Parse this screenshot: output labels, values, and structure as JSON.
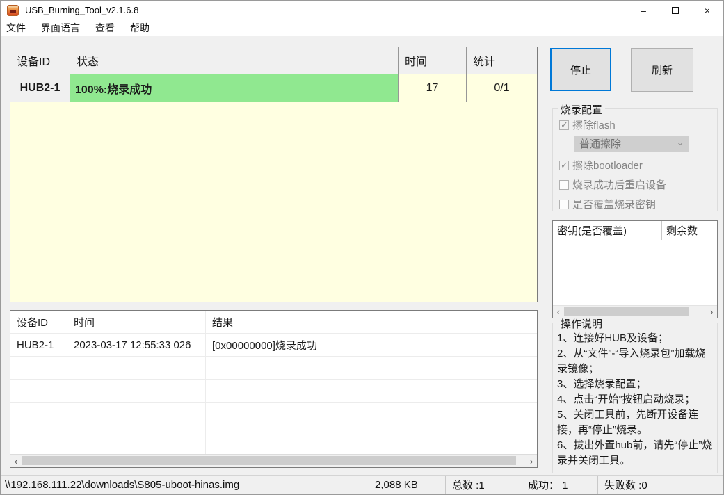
{
  "window": {
    "title": "USB_Burning_Tool_v2.1.6.8"
  },
  "menu": {
    "items": [
      "文件",
      "界面语言",
      "查看",
      "帮助"
    ]
  },
  "device_table": {
    "headers": [
      "设备ID",
      "状态",
      "时间",
      "统计"
    ],
    "rows": [
      {
        "id": "HUB2-1",
        "status": "100%:烧录成功",
        "time": "17",
        "stat": "0/1"
      }
    ]
  },
  "toolbar": {
    "stop_label": "停止",
    "refresh_label": "刷新"
  },
  "burn_config": {
    "title": "烧录配置",
    "erase_flash_label": "擦除flash",
    "erase_flash_checked": true,
    "erase_mode_value": "普通擦除",
    "erase_bootloader_label": "擦除bootloader",
    "erase_bootloader_checked": true,
    "reboot_label": "烧录成功后重启设备",
    "reboot_checked": false,
    "overwrite_key_label": "是否覆盖烧录密钥",
    "overwrite_key_checked": false
  },
  "key_table": {
    "headers": [
      "密钥(是否覆盖)",
      "剩余数"
    ],
    "rows": []
  },
  "instructions": {
    "title": "操作说明",
    "steps": [
      "1、连接好HUB及设备；",
      "2、从“文件”-“导入烧录包”加载烧录镜像；",
      "3、选择烧录配置；",
      "4、点击“开始”按钮启动烧录；",
      "5、关闭工具前，先断开设备连接，再“停止”烧录。",
      "6、拔出外置hub前，请先“停止”烧录并关闭工具。"
    ]
  },
  "log_table": {
    "headers": [
      "设备ID",
      "时间",
      "结果"
    ],
    "rows": [
      {
        "id": "HUB2-1",
        "time": "2023-03-17 12:55:33 026",
        "result": "[0x00000000]烧录成功"
      }
    ]
  },
  "statusbar": {
    "path": "\\\\192.168.111.22\\downloads\\S805-uboot-hinas.img",
    "size": "2,088 KB",
    "total": "总数 :1",
    "success": "成功： 1",
    "failed": "失败数 :0"
  },
  "colors": {
    "accent_blue": "#0078d7",
    "success_green": "#90e890",
    "queue_yellow": "#ffffe1",
    "window_bg": "#f0f0f0"
  }
}
